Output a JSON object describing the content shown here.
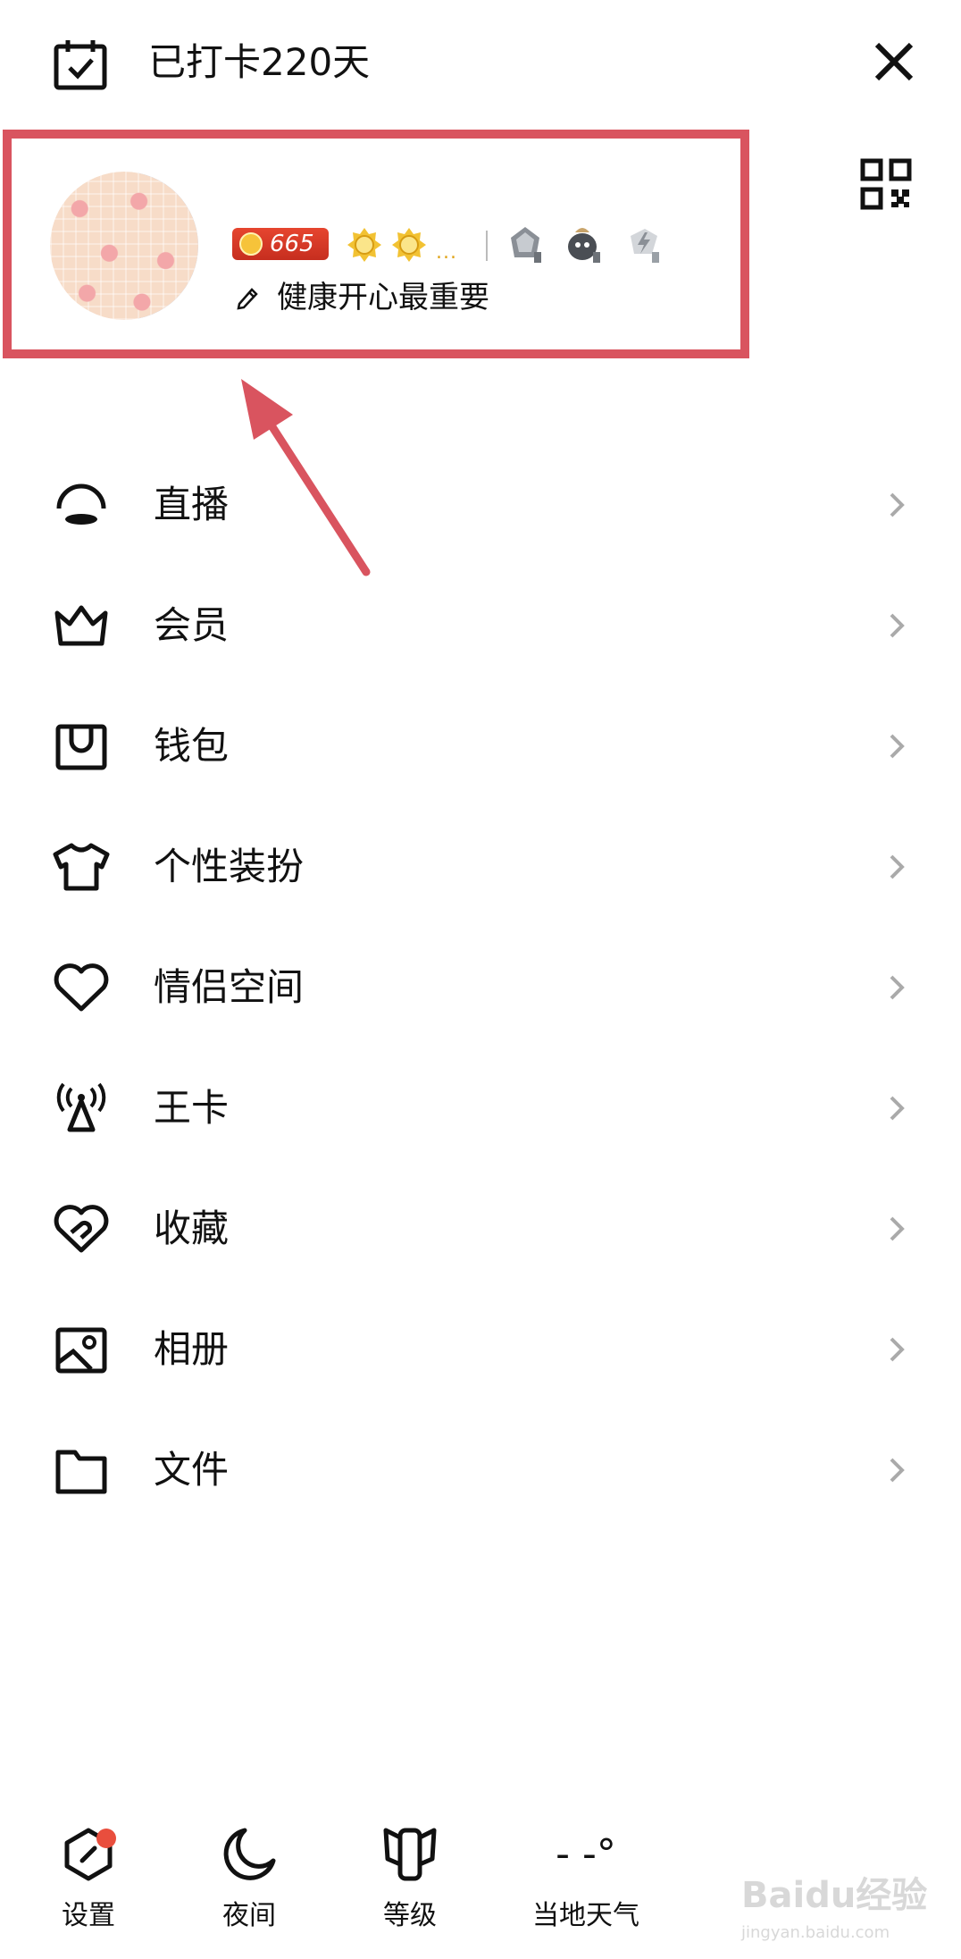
{
  "header": {
    "checkin_text": "已打卡220天"
  },
  "profile": {
    "level": "665",
    "signature": "健康开心最重要",
    "more_indicator": "..."
  },
  "menu": [
    {
      "label": "直播",
      "icon": "live-icon"
    },
    {
      "label": "会员",
      "icon": "crown-icon"
    },
    {
      "label": "钱包",
      "icon": "wallet-icon"
    },
    {
      "label": "个性装扮",
      "icon": "tshirt-icon"
    },
    {
      "label": "情侣空间",
      "icon": "heart-icon"
    },
    {
      "label": "王卡",
      "icon": "signal-tower-icon"
    },
    {
      "label": "收藏",
      "icon": "favorite-heart-icon"
    },
    {
      "label": "相册",
      "icon": "photo-album-icon"
    },
    {
      "label": "文件",
      "icon": "folder-icon"
    }
  ],
  "bottom_bar": {
    "settings": "设置",
    "night": "夜间",
    "level": "等级",
    "weather_label": "当地天气",
    "weather_temp": "- -°"
  },
  "watermark": {
    "main": "Baidu经验",
    "sub": "jingyan.baidu.com"
  },
  "colors": {
    "highlight": "#d9545f",
    "level_badge": "#d63a27",
    "notification_dot": "#e94e3d"
  }
}
